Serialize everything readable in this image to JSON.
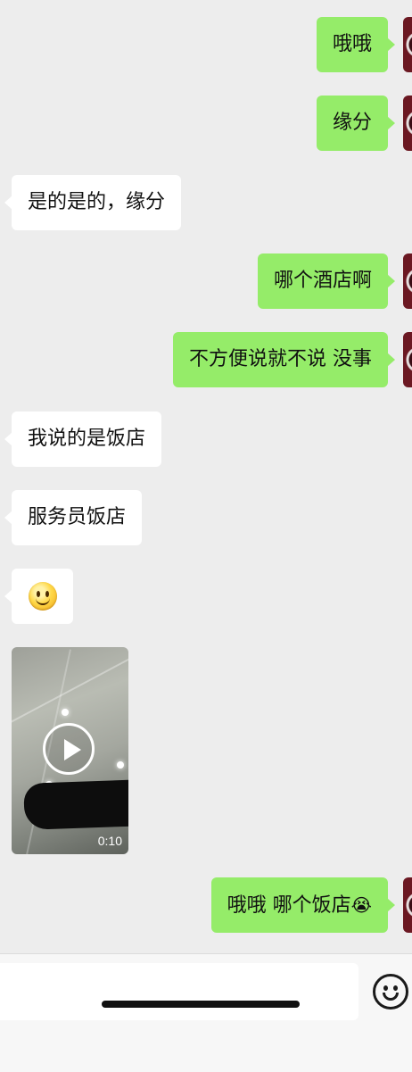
{
  "messages": [
    {
      "side": "out",
      "text": "哦哦"
    },
    {
      "side": "out",
      "text": "缘分"
    },
    {
      "side": "in",
      "text": "是的是的，缘分"
    },
    {
      "side": "out",
      "text": "哪个酒店啊"
    },
    {
      "side": "out",
      "text": "不方便说就不说 没事"
    },
    {
      "side": "in",
      "text": "我说的是饭店"
    },
    {
      "side": "in",
      "text": "服务员饭店"
    },
    {
      "side": "in",
      "sticker": "smile-emoji"
    },
    {
      "side": "in",
      "video": {
        "duration": "0:10"
      }
    },
    {
      "side": "out",
      "text": "哦哦 哪个饭店",
      "emoji": "😭"
    }
  ],
  "input_bar": {
    "placeholder": "",
    "emoji_button_icon": "smiley-face-icon"
  },
  "colors": {
    "background": "#ededed",
    "outgoing_bubble": "#95ec69",
    "incoming_bubble": "#ffffff"
  }
}
